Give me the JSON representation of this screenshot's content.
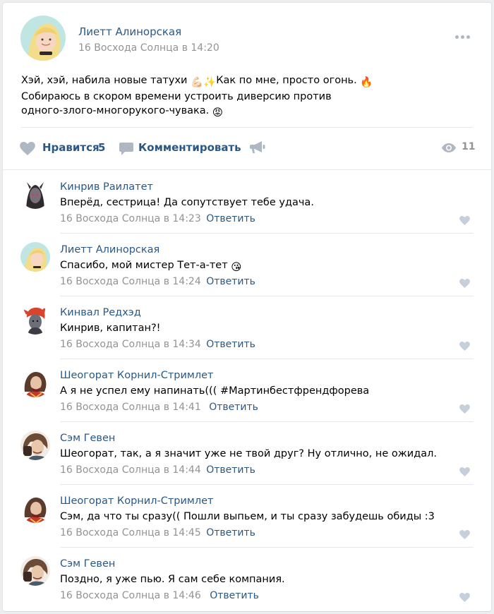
{
  "post": {
    "author": "Лиетт Алинорская",
    "date": "16 Восхода Солнца в 14:20",
    "text_line1": "Хэй, хэй, набила новые татухи ",
    "text_line1b": "Как по мне, просто огонь. ",
    "text_line2": "Собираюсь в скором времени устроить диверсию против",
    "text_line3": "одного-злого-многорукого-чувака. ",
    "emoji_1": "💪🏻",
    "emoji_2": "✨",
    "emoji_3": "🔥",
    "emoji_4": "😡"
  },
  "actions": {
    "like_label": "Нравится",
    "like_count": "5",
    "comment_label": "Комментировать",
    "views_count": "11"
  },
  "comments": [
    {
      "author": "Кинрив Раилатет",
      "text": "Вперёд, сестрица! Да сопутствует тебе удача.",
      "date": "16 Восхода Солнца в 14:23",
      "reply": "Ответить"
    },
    {
      "author": "Лиетт Алинорская",
      "text": "Спасибо, мой мистер Тет-а-тет ",
      "emoji": "😘",
      "date": "16 Восхода Солнца в 14:24",
      "reply": "Ответить"
    },
    {
      "author": "Кинвал Редхэд",
      "text": "Кинрив, капитан?!",
      "date": "16 Восхода Солнца в 14:34",
      "reply": "Ответить"
    },
    {
      "author": "Шеогорат Корнил-Стримлет",
      "text": "А я не успел ему напинать((( #Мартинбестфрендфорева",
      "date": "16 Восхода Солнца в 14:41",
      "reply": "Ответить"
    },
    {
      "author": "Сэм Гевен",
      "text": "Шеогорат, так, а я значит уже не твой друг? Ну отлично, не ожидал.",
      "date": "16 Восхода Солнца в 14:44",
      "reply": "Ответить"
    },
    {
      "author": "Шеогорат Корнил-Стримлет",
      "text": "Сэм, да что ты сразу(( Пошли выпьем, и ты сразу забудешь обиды :3",
      "date": "16 Восхода Солнца в 14:45",
      "reply": "Ответить"
    },
    {
      "author": "Сэм Гевен",
      "text": "Поздно, я уже пью. Я сам себе компания.",
      "date": "16 Восхода Солнца в 14:46",
      "reply": "Ответить"
    }
  ],
  "colors": {
    "link": "#2a5885",
    "meta": "#939393",
    "background": "#edeef0",
    "icon": "#aeb7c2"
  }
}
